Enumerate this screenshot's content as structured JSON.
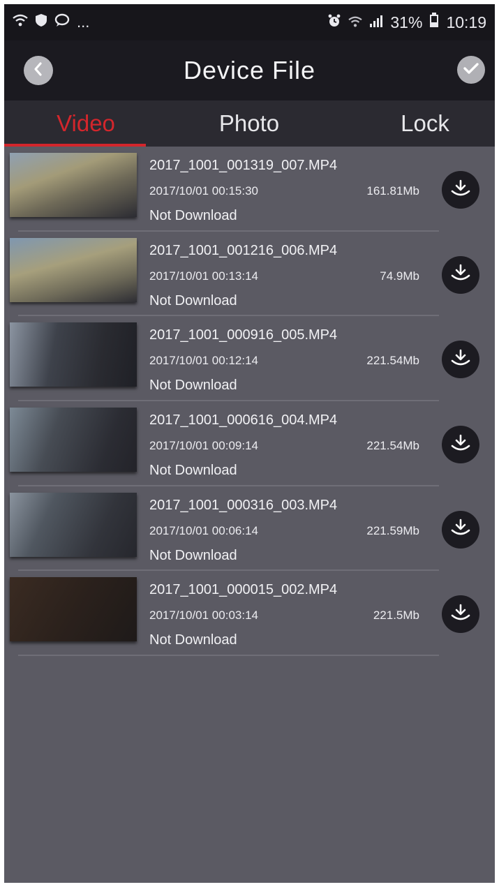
{
  "status_bar": {
    "left_icons": [
      "wifi-icon",
      "shield-icon",
      "chat-icon"
    ],
    "left_more": "...",
    "battery": "31%",
    "time": "10:19"
  },
  "header": {
    "title": "Device File"
  },
  "tabs": [
    {
      "label": "Video",
      "active": true
    },
    {
      "label": "Photo",
      "active": false
    },
    {
      "label": "Lock",
      "active": false
    }
  ],
  "files": [
    {
      "name": "2017_1001_001319_007.MP4",
      "datetime": "2017/10/01 00:15:30",
      "size": "161.81Mb",
      "status": "Not Download"
    },
    {
      "name": "2017_1001_001216_006.MP4",
      "datetime": "2017/10/01 00:13:14",
      "size": "74.9Mb",
      "status": "Not Download"
    },
    {
      "name": "2017_1001_000916_005.MP4",
      "datetime": "2017/10/01 00:12:14",
      "size": "221.54Mb",
      "status": "Not Download"
    },
    {
      "name": "2017_1001_000616_004.MP4",
      "datetime": "2017/10/01 00:09:14",
      "size": "221.54Mb",
      "status": "Not Download"
    },
    {
      "name": "2017_1001_000316_003.MP4",
      "datetime": "2017/10/01 00:06:14",
      "size": "221.59Mb",
      "status": "Not Download"
    },
    {
      "name": "2017_1001_000015_002.MP4",
      "datetime": "2017/10/01 00:03:14",
      "size": "221.5Mb",
      "status": "Not Download"
    }
  ],
  "colors": {
    "accent": "#d3262c",
    "background": "#5b5a63",
    "header": "#1b1a20"
  }
}
